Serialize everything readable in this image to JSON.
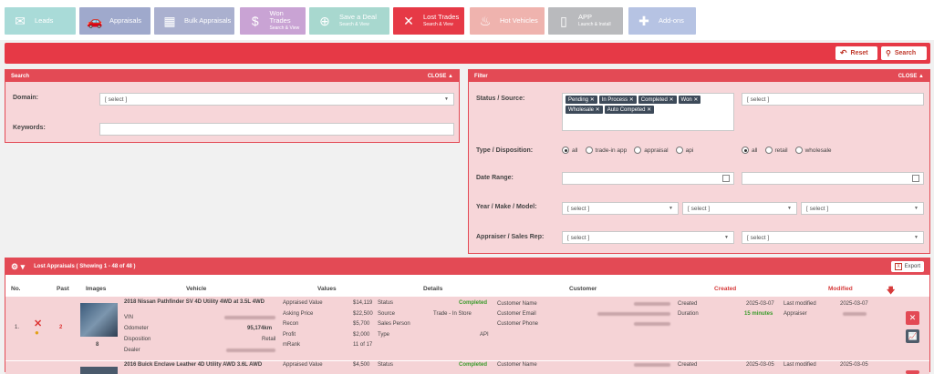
{
  "nav": {
    "items": [
      {
        "label": "Leads",
        "sub": "",
        "color": "#a9dbd8",
        "icon": "envelope-icon",
        "glyph": "✉"
      },
      {
        "label": "Appraisals",
        "sub": "",
        "color": "#9fa9cc",
        "icon": "car-icon",
        "glyph": "🚗"
      },
      {
        "label": "Bulk Appraisals",
        "sub": "",
        "color": "#aab0cf",
        "icon": "calculator-icon",
        "glyph": "▦"
      },
      {
        "label": "Won Trades",
        "sub": "Search & View",
        "color": "#c9a3d4",
        "icon": "document-dollar-icon",
        "glyph": "$"
      },
      {
        "label": "Save a Deal",
        "sub": "Search & View",
        "color": "#a8d8cf",
        "icon": "lifebuoy-icon",
        "glyph": "⊕"
      },
      {
        "label": "Lost Trades",
        "sub": "Search & View",
        "color": "#e63946",
        "icon": "x-icon",
        "glyph": "✕"
      },
      {
        "label": "Hot Vehicles",
        "sub": "",
        "color": "#efb3ae",
        "icon": "flame-icon",
        "glyph": "♨"
      },
      {
        "label": "APP",
        "sub": "Launch & Install",
        "color": "#b9babd",
        "icon": "tablet-icon",
        "glyph": "▯"
      },
      {
        "label": "Add-ons",
        "sub": "",
        "color": "#b6c3e3",
        "icon": "puzzle-icon",
        "glyph": "✚"
      }
    ]
  },
  "toolbar": {
    "reset_label": "Reset",
    "search_label": "Search"
  },
  "search_panel": {
    "title": "Search",
    "close_label": "CLOSE ▲",
    "domain_label": "Domain:",
    "domain_value": "[ select ]",
    "keywords_label": "Keywords:"
  },
  "filter_panel": {
    "title": "Filter",
    "close_label": "CLOSE ▲",
    "status_label": "Status / Source:",
    "status_tags": [
      "Pending",
      "In Process",
      "Completed",
      "Won",
      "Wholesale",
      "Auto Competed"
    ],
    "source_value": "[ select ]",
    "type_label": "Type / Disposition:",
    "type_options": [
      "all",
      "trade-in app",
      "appraisal",
      "api"
    ],
    "disposition_options": [
      "all",
      "retail",
      "wholesale"
    ],
    "date_label": "Date Range:",
    "ymm_label": "Year / Make / Model:",
    "year_value": "[ select ]",
    "make_value": "[ select ]",
    "model_value": "[ select ]",
    "appraiser_label": "Appraiser / Sales Rep:",
    "appraiser_value": "[ select ]",
    "salesrep_value": "[ select ]"
  },
  "table": {
    "title": "Lost Appraisals ( Showing 1 - 48 of 48 )",
    "export_label": "Export",
    "headers": {
      "no": "No.",
      "past": "Past",
      "images": "Images",
      "vehicle": "Vehicle",
      "values": "Values",
      "details": "Details",
      "customer": "Customer",
      "created": "Created",
      "modified": "Modified"
    },
    "rows": [
      {
        "no": "1.",
        "past": "2",
        "image_count": "8",
        "vehicle_title": "2018 Nissan Pathfinder SV 4D Utility 4WD at 3.5L 4WD",
        "vin_label": "VIN",
        "odometer_label": "Odometer",
        "odometer": "95,174km",
        "disposition_label": "Disposition",
        "disposition": "Retail",
        "dealer_label": "Dealer",
        "values": [
          {
            "label": "Appraised Value",
            "value": "$14,119"
          },
          {
            "label": "Asking Price",
            "value": "$22,500"
          },
          {
            "label": "Recon",
            "value": "$5,700"
          },
          {
            "label": "Profit",
            "value": "$2,000"
          },
          {
            "label": "mRank",
            "value": "11 of 17"
          }
        ],
        "details": [
          {
            "label": "Status",
            "value": "Completed"
          },
          {
            "label": "Source",
            "value": "Trade - In Store"
          },
          {
            "label": "Sales Person",
            "value": ""
          },
          {
            "label": "Type",
            "value": "API"
          }
        ],
        "customer_name_label": "Customer Name",
        "customer_email_label": "Customer Email",
        "customer_phone_label": "Customer Phone",
        "created_label": "Created",
        "created": "2025-03-07",
        "duration_label": "Duration",
        "duration": "15 minutes",
        "modified_label": "Last modified",
        "modified": "2025-03-07",
        "appraiser_label": "Appraiser"
      },
      {
        "vehicle_title": "2016 Buick Enclave Leather 4D Utility AWD 3.6L AWD",
        "appraised_label": "Appraised Value",
        "appraised": "$4,500",
        "status_label": "Status",
        "status": "Completed",
        "customer_name_label": "Customer Name",
        "created_label": "Created",
        "created": "2025-03-05",
        "modified_label": "Last modified",
        "modified": "2025-03-05"
      }
    ]
  }
}
